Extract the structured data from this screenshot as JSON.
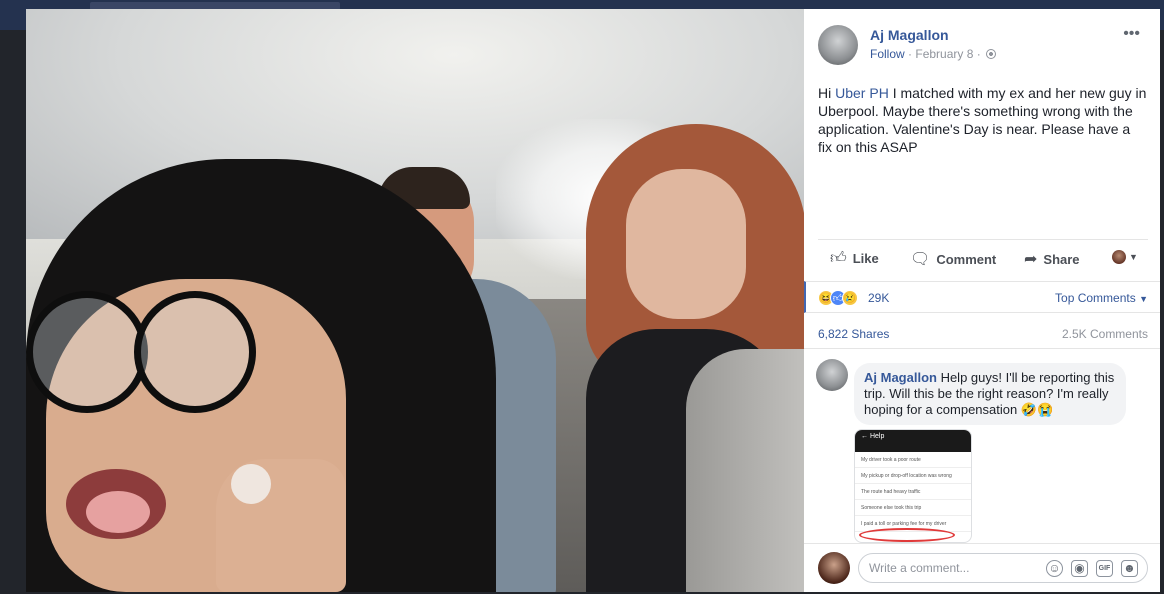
{
  "post": {
    "author": "Aj Magallon",
    "follow_label": "Follow",
    "date_sep": " · ",
    "date": "February 8",
    "date_suffix": " · ",
    "text_prefix": "Hi ",
    "mention": "Uber PH",
    "text_suffix": " I matched with my ex and her new guy in Uberpool. Maybe there's something wrong with the application. Valentine's Day is near. Please have a fix on this ASAP",
    "more_icon": "more-options-icon"
  },
  "actions": {
    "like": "Like",
    "comment": "Comment",
    "share": "Share",
    "like_icon": "thumbs-up-icon",
    "comment_icon": "speech-bubble-icon",
    "share_icon": "share-arrow-icon"
  },
  "reactions": {
    "count": "29K",
    "top_comments": "Top Comments",
    "icons": [
      "haha-icon",
      "like-icon",
      "sad-icon"
    ]
  },
  "stats": {
    "shares": "6,822 Shares",
    "comments": "2.5K Comments"
  },
  "comment": {
    "author": "Aj Magallon",
    "text": " Help guys! I'll be reporting this trip. Will this be the right reason? I'm really hoping for a compensation 🤣😭",
    "image": {
      "header": "← Help",
      "options": [
        "My driver took a poor route",
        "My pickup or drop-off location was wrong",
        "The route had heavy traffic",
        "Someone else took this trip",
        "I paid a toll or parking fee for my driver"
      ]
    }
  },
  "composer": {
    "placeholder": "Write a comment...",
    "icons": [
      "emoji-icon",
      "camera-icon",
      "gif-icon",
      "sticker-icon"
    ],
    "gif_label": "GIF"
  },
  "colors": {
    "link_blue": "#365899",
    "accent_blue": "#4267b2",
    "meta_gray": "#90949c"
  }
}
